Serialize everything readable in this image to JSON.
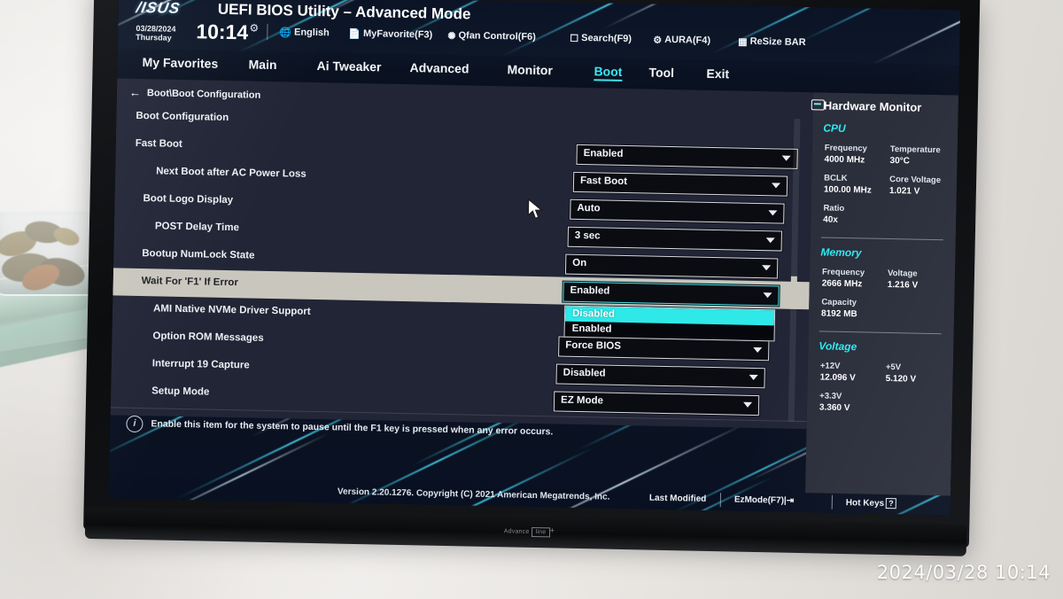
{
  "header": {
    "brand": "/ISUS",
    "title": "UEFI BIOS Utility – Advanced Mode",
    "date": "03/28/2024",
    "weekday": "Thursday",
    "time": "10:14",
    "gear_icon": "gear-icon",
    "items": [
      {
        "icon": "globe-icon",
        "label": "English"
      },
      {
        "icon": "myfavorite-icon",
        "label": "MyFavorite(F3)"
      },
      {
        "icon": "fan-icon",
        "label": "Qfan Control(F6)"
      },
      {
        "icon": "search-icon",
        "label": "Search(F9)"
      },
      {
        "icon": "aura-icon",
        "label": "AURA(F4)"
      },
      {
        "icon": "resizebar-icon",
        "label": "ReSize BAR"
      }
    ]
  },
  "tabs": [
    {
      "label": "My Favorites",
      "active": false
    },
    {
      "label": "Main",
      "active": false
    },
    {
      "label": "Ai Tweaker",
      "active": false
    },
    {
      "label": "Advanced",
      "active": false
    },
    {
      "label": "Monitor",
      "active": false
    },
    {
      "label": "Boot",
      "active": true
    },
    {
      "label": "Tool",
      "active": false
    },
    {
      "label": "Exit",
      "active": false
    }
  ],
  "breadcrumb": "Boot\\Boot Configuration",
  "settings": [
    {
      "label": "Boot Configuration",
      "indent": 0,
      "type": "heading",
      "value": "",
      "highlight": false
    },
    {
      "label": "Fast Boot",
      "indent": 0,
      "type": "select",
      "value": "Enabled",
      "highlight": false
    },
    {
      "label": "Next Boot after AC Power Loss",
      "indent": 2,
      "type": "select",
      "value": "Fast Boot",
      "highlight": false
    },
    {
      "label": "Boot Logo Display",
      "indent": 1,
      "type": "select",
      "value": "Auto",
      "highlight": false
    },
    {
      "label": "POST Delay Time",
      "indent": 2,
      "type": "select",
      "value": "3 sec",
      "highlight": false
    },
    {
      "label": "Bootup NumLock State",
      "indent": 1,
      "type": "select",
      "value": "On",
      "highlight": false
    },
    {
      "label": "Wait For 'F1' If Error",
      "indent": 1,
      "type": "select",
      "value": "Enabled",
      "highlight": true
    },
    {
      "label": "AMI Native NVMe Driver Support",
      "indent": 2,
      "type": "select",
      "value": "",
      "highlight": false
    },
    {
      "label": "Option ROM Messages",
      "indent": 2,
      "type": "select",
      "value": "Force BIOS",
      "highlight": false
    },
    {
      "label": "Interrupt 19 Capture",
      "indent": 2,
      "type": "select",
      "value": "Disabled",
      "highlight": false
    },
    {
      "label": "Setup Mode",
      "indent": 2,
      "type": "select",
      "value": "EZ Mode",
      "highlight": false
    }
  ],
  "dropdown": {
    "open": true,
    "options": [
      {
        "label": "Disabled",
        "selected": true
      },
      {
        "label": "Enabled",
        "selected": false
      }
    ]
  },
  "help": {
    "icon": "info-icon",
    "text": "Enable this item for the system to pause until the F1 key is pressed when any error occurs."
  },
  "hardware_monitor": {
    "title": "Hardware Monitor",
    "icon": "monitor-icon",
    "sections": [
      {
        "name": "CPU",
        "rows": [
          [
            {
              "k": "Frequency",
              "v": "4000 MHz"
            },
            {
              "k": "Temperature",
              "v": "30°C"
            }
          ],
          [
            {
              "k": "BCLK",
              "v": "100.00 MHz"
            },
            {
              "k": "Core Voltage",
              "v": "1.021 V"
            }
          ],
          [
            {
              "k": "Ratio",
              "v": "40x"
            }
          ]
        ]
      },
      {
        "name": "Memory",
        "rows": [
          [
            {
              "k": "Frequency",
              "v": "2666 MHz"
            },
            {
              "k": "Voltage",
              "v": "1.216 V"
            }
          ],
          [
            {
              "k": "Capacity",
              "v": "8192 MB"
            }
          ]
        ]
      },
      {
        "name": "Voltage",
        "rows": [
          [
            {
              "k": "+12V",
              "v": "12.096 V"
            },
            {
              "k": "+5V",
              "v": "5.120 V"
            }
          ],
          [
            {
              "k": "+3.3V",
              "v": "3.360 V"
            }
          ]
        ]
      }
    ]
  },
  "footer": {
    "version": "Version 2.20.1276. Copyright (C) 2021 American Megatrends, Inc.",
    "last_modified": "Last Modified",
    "ezmode": "EzMode(F7)|",
    "hotkeys": "Hot Keys",
    "hotkeys_key": "?"
  },
  "bezel_logo": {
    "text": "Advance",
    "sub": "line",
    "plus": "+"
  },
  "photo_stamp": "2024/03/28  10:14",
  "colors": {
    "accent_cyan": "#2fe8f0",
    "panel_bg": "#222536",
    "hw_bg": "#2b2e3b",
    "highlight_row": "#c9c7bd"
  }
}
